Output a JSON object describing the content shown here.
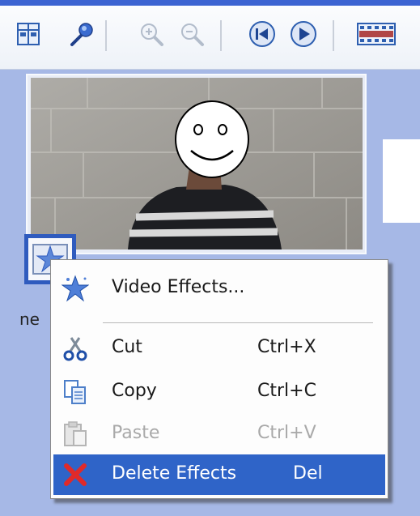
{
  "toolbar": {
    "icons": [
      "storyboard-icon",
      "narrate-icon",
      "zoom-in-icon",
      "zoom-out-icon",
      "rewind-icon",
      "play-icon",
      "timeline-icon"
    ],
    "accent": "#3c64d2"
  },
  "clip": {
    "label": "ne"
  },
  "context_menu": {
    "items": [
      {
        "label": "Video Effects...",
        "shortcut": "",
        "icon": "video-effects-star-icon",
        "state": "normal"
      },
      {
        "label": "Cut",
        "shortcut": "Ctrl+X",
        "icon": "scissors-icon",
        "state": "normal"
      },
      {
        "label": "Copy",
        "shortcut": "Ctrl+C",
        "icon": "copy-icon",
        "state": "normal"
      },
      {
        "label": "Paste",
        "shortcut": "Ctrl+V",
        "icon": "paste-icon",
        "state": "disabled"
      },
      {
        "label": "Delete Effects",
        "shortcut": "Del",
        "icon": "delete-x-icon",
        "state": "selected"
      }
    ],
    "highlight_color": "#2f64c8"
  }
}
